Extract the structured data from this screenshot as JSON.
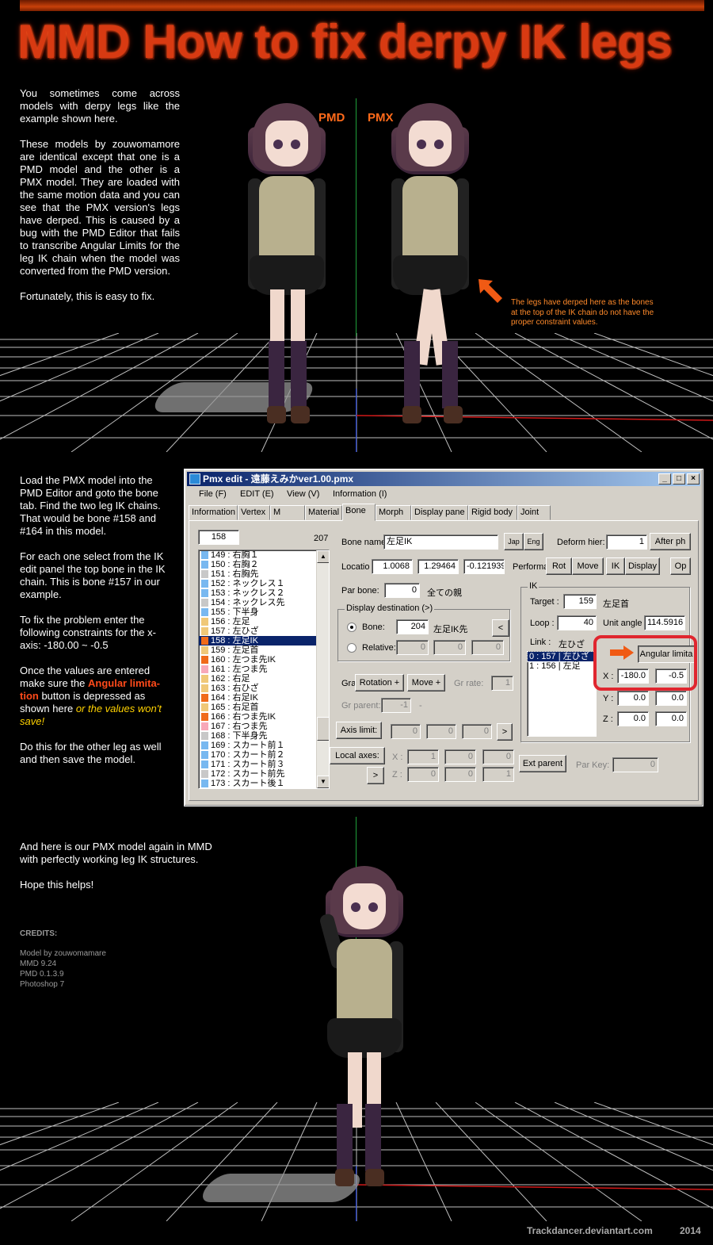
{
  "title": "MMD How to fix derpy IK legs",
  "intro": {
    "p1": "You sometimes come across models with derpy legs like the example shown here.",
    "p2": "These models by zouwomamore are identical except that one is a PMD model and the other is a PMX model. They are loaded with the same motion data and you can see that the PMX version's legs have derped. This is caused by a bug with the PMD Editor that fails to transcribe Angular Limits for the leg IK chain when the model was converted from the PMD version.",
    "p3": "Fortunately, this is easy to fix."
  },
  "scene1": {
    "label_left": "PMD",
    "label_right": "PMX",
    "annotation": "The legs have derped here as the bones at the top of the IK chain do not have the proper constraint values."
  },
  "steps": {
    "p1": "Load the PMX model into the PMD Editor and goto the bone tab. Find the two leg IK chains. That would be bone #158 and #164 in this model.",
    "p2": "For each one select from the IK edit panel the top bone in the IK chain. This is bone #157 in our example.",
    "p3": "To fix the problem enter the following constraints for the x-axis: -180.00 ~ -0.5",
    "p4_a": "Once the values are entered make sure the ",
    "p4_highlight": "Angular limita-tion",
    "p4_b": " button is depressed as shown here ",
    "p4_italic": "or the values won't save!",
    "p5": "Do this for the other leg as well and then save the model."
  },
  "editor": {
    "window_title": "Pmx edit - 遠藤えみかver1.00.pmx",
    "menu": [
      "File (F)",
      "EDIT (E)",
      "View (V)",
      "Information (I)"
    ],
    "tabs": [
      "Information",
      "Vertex",
      "M",
      "Material",
      "Bone",
      "Morph",
      "Display pane",
      "Rigid body",
      "Joint"
    ],
    "active_tab": "Bone",
    "bone_index": "158",
    "bone_total": "207",
    "bones": [
      {
        "label": "149 : 右胸１",
        "color": "#78b8f0"
      },
      {
        "label": "150 : 右胸２",
        "color": "#78b8f0"
      },
      {
        "label": "151 : 右胸先",
        "color": "#c8c8c8"
      },
      {
        "label": "152 : ネックレス１",
        "color": "#78b8f0"
      },
      {
        "label": "153 : ネックレス２",
        "color": "#78b8f0"
      },
      {
        "label": "154 : ネックレス先",
        "color": "#c8c8c8"
      },
      {
        "label": "155 : 下半身",
        "color": "#78b8f0"
      },
      {
        "label": "156 : 左足",
        "color": "#f0c878"
      },
      {
        "label": "157 : 左ひざ",
        "color": "#f0c878"
      },
      {
        "label": "158 : 左足IK",
        "color": "#f06a1a",
        "selected": true
      },
      {
        "label": "159 : 左足首",
        "color": "#f0c878"
      },
      {
        "label": "160 : 左つま先IK",
        "color": "#f06a1a"
      },
      {
        "label": "161 : 左つま先",
        "color": "#f8a8b8"
      },
      {
        "label": "162 : 右足",
        "color": "#f0c878"
      },
      {
        "label": "163 : 右ひざ",
        "color": "#f0c878"
      },
      {
        "label": "164 : 右足IK",
        "color": "#f06a1a"
      },
      {
        "label": "165 : 右足首",
        "color": "#f0c878"
      },
      {
        "label": "166 : 右つま先IK",
        "color": "#f06a1a"
      },
      {
        "label": "167 : 右つま先",
        "color": "#f8a8b8"
      },
      {
        "label": "168 : 下半身先",
        "color": "#c8c8c8"
      },
      {
        "label": "169 : スカート前１",
        "color": "#78b8f0"
      },
      {
        "label": "170 : スカート前２",
        "color": "#78b8f0"
      },
      {
        "label": "171 : スカート前３",
        "color": "#78b8f0"
      },
      {
        "label": "172 : スカート前先",
        "color": "#c8c8c8"
      },
      {
        "label": "173 : スカート後１",
        "color": "#78b8f0"
      }
    ],
    "bone_name_label": "Bone name",
    "bone_name": "左足IK",
    "jap_btn": "Jap",
    "eng_btn": "Eng",
    "deform_label": "Deform hier:",
    "deform_value": "1",
    "after_ph": "After ph",
    "location_label": "Locatio",
    "loc_x": "1.0068",
    "loc_y": "1.29464",
    "loc_z": "-0.121939",
    "perf_label": "Performa",
    "perf_buttons": [
      "Rot",
      "Move",
      "IK",
      "Display"
    ],
    "op_btn": "Op",
    "par_bone_label": "Par bone:",
    "par_bone_value": "0",
    "par_bone_name": "全ての親",
    "display_dest_title": "Display destination (>)",
    "bone_radio": "Bone:",
    "bone_radio_value": "204",
    "bone_radio_name": "左足IK先",
    "lt_btn": "<",
    "relative_radio": "Relative:",
    "relative_values": [
      "0",
      "0",
      "0"
    ],
    "gra_label": "Gra",
    "rotation_plus": "Rotation +",
    "move_plus": "Move +",
    "gr_rate_label": "Gr rate:",
    "gr_rate_value": "1",
    "gr_parent_label": "Gr parent:",
    "gr_parent_value": "-1",
    "gr_parent_name": "-",
    "axis_limit_btn": "Axis limit:",
    "axis_values": [
      "0",
      "0",
      "0"
    ],
    "gt_btn": ">",
    "local_axes_btn": "Local axes:",
    "local_x_label": "X :",
    "local_x_values": [
      "1",
      "0",
      "0"
    ],
    "local_z_label": "Z :",
    "local_z_values": [
      "0",
      "0",
      "1"
    ],
    "ext_parent_btn": "Ext parent",
    "par_key_label": "Par Key:",
    "par_key_value": "0",
    "ik_title": "IK",
    "target_label": "Target :",
    "target_value": "159",
    "target_name": "左足首",
    "loop_label": "Loop :",
    "loop_value": "40",
    "unit_angle_label": "Unit angle",
    "unit_angle_value": "114.5916",
    "link_label": "Link :",
    "link_name": "左ひざ",
    "links": [
      "0 : 157 | 左ひざ",
      "1 : 156 | 左足"
    ],
    "angular_btn": "Angular limita",
    "x_label": "X :",
    "x_min": "-180.0",
    "x_max": "-0.5",
    "y_label": "Y :",
    "y_min": "0.0",
    "y_max": "0.0",
    "z_label": "Z :",
    "z_min": "0.0",
    "z_max": "0.0"
  },
  "outro": {
    "p1": "And here is our PMX model again in MMD with perfectly working leg IK structures.",
    "p2": "Hope this helps!"
  },
  "credits": {
    "title": "CREDITS:",
    "lines": [
      "Model by zouwomamare",
      "MMD 9.24",
      "PMD 0.1.3.9",
      "Photoshop 7"
    ]
  },
  "footer": {
    "site": "Trackdancer.deviantart.com",
    "year": "2014"
  },
  "colors": {
    "title": "#d83a12",
    "accent": "#ff4a1a",
    "highlight_yellow": "#ffd200",
    "annotation": "#ff8a2a",
    "red_box": "#e0262f"
  }
}
